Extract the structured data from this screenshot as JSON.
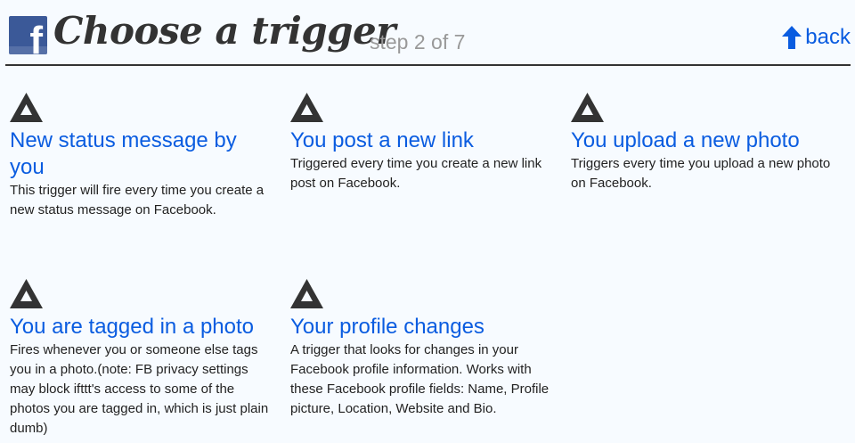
{
  "header": {
    "title": "Choose a trigger",
    "step": "step 2 of 7",
    "back_label": "back"
  },
  "triggers": [
    {
      "name": "New status message by you",
      "description": "This trigger will fire every time you create a new status message on Facebook."
    },
    {
      "name": "You post a new link",
      "description": "Triggered every time you create a new link post on Facebook."
    },
    {
      "name": "You upload a new photo",
      "description": "Triggers every time you upload a new photo on Facebook."
    },
    {
      "name": "You are tagged in a photo",
      "description": "Fires whenever you or someone else tags you in a photo.(note: FB privacy settings may block ifttt's access to some of the photos you are tagged in, which is just plain dumb)"
    },
    {
      "name": "Your profile changes",
      "description": "A trigger that looks for changes in your Facebook profile information. Works with these Facebook profile fields: Name, Profile picture, Location, Website and Bio."
    }
  ],
  "icons": {
    "logo": "facebook-logo-icon",
    "back": "up-arrow-icon",
    "trigger": "triangle-trigger-icon"
  },
  "colors": {
    "background": "#f7fbff",
    "link": "#0a5ce0",
    "facebook_blue": "#3b5998",
    "step_text": "#999999"
  }
}
